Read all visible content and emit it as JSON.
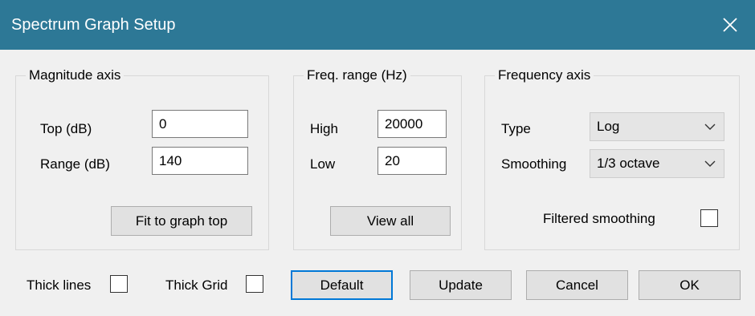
{
  "window": {
    "title": "Spectrum Graph Setup",
    "close_icon": "close-icon"
  },
  "magnitude_axis": {
    "legend": "Magnitude axis",
    "top_label": "Top (dB)",
    "top_value": "0",
    "range_label": "Range (dB)",
    "range_value": "140",
    "fit_button": "Fit to graph top"
  },
  "freq_range": {
    "legend": "Freq. range (Hz)",
    "high_label": "High",
    "high_value": "20000",
    "low_label": "Low",
    "low_value": "20",
    "view_all_button": "View all"
  },
  "frequency_axis": {
    "legend": "Frequency axis",
    "type_label": "Type",
    "type_value": "Log",
    "smoothing_label": "Smoothing",
    "smoothing_value": "1/3 octave",
    "filtered_smoothing_label": "Filtered smoothing",
    "filtered_smoothing_checked": false
  },
  "footer": {
    "thick_lines_label": "Thick lines",
    "thick_lines_checked": false,
    "thick_grid_label": "Thick Grid",
    "thick_grid_checked": false,
    "default_button": "Default",
    "update_button": "Update",
    "cancel_button": "Cancel",
    "ok_button": "OK"
  },
  "colors": {
    "titlebar": "#2d7896",
    "focus_border": "#0078d7",
    "dialog_background": "#f0f0f0"
  }
}
